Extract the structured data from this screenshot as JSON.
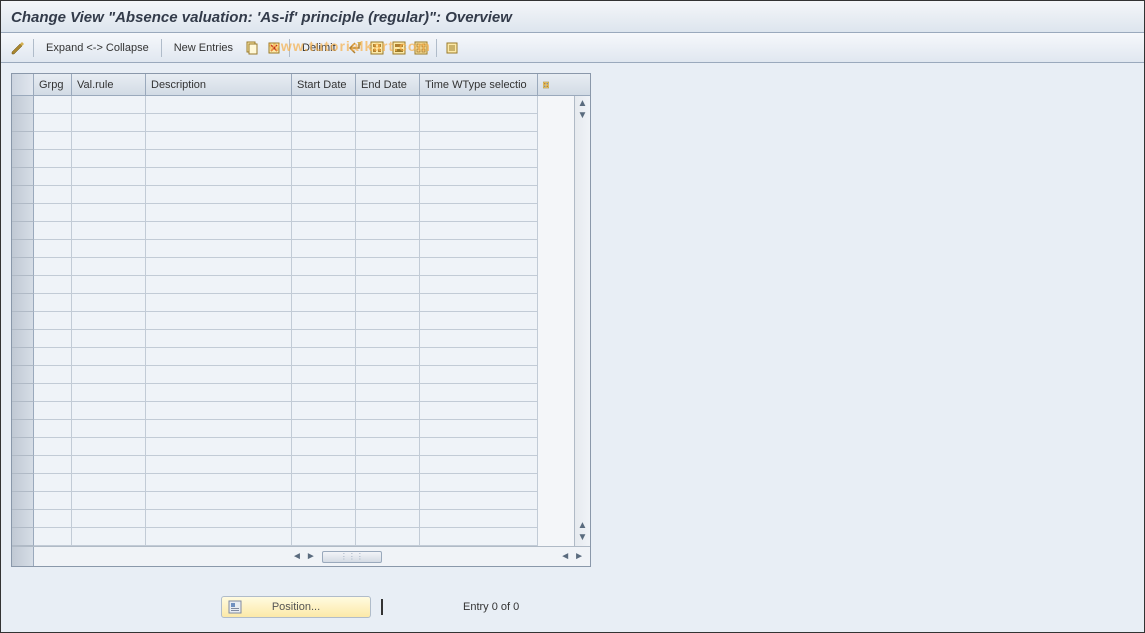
{
  "header": {
    "title": "Change View \"Absence valuation: 'As-if' principle (regular)\": Overview"
  },
  "toolbar": {
    "expand_collapse_label": "Expand <-> Collapse",
    "new_entries_label": "New Entries",
    "delimit_label": "Delimit"
  },
  "watermark": "www.tutorialkart.com",
  "table": {
    "columns": {
      "grpg": "Grpg",
      "valrule": "Val.rule",
      "description": "Description",
      "start_date": "Start Date",
      "end_date": "End Date",
      "time_wtype": "Time WType selectio"
    },
    "rows": [
      {},
      {},
      {},
      {},
      {},
      {},
      {},
      {},
      {},
      {},
      {},
      {},
      {},
      {},
      {},
      {},
      {},
      {},
      {},
      {},
      {},
      {},
      {},
      {},
      {}
    ]
  },
  "footer": {
    "position_label": "Position...",
    "entry_text": "Entry 0 of 0"
  }
}
